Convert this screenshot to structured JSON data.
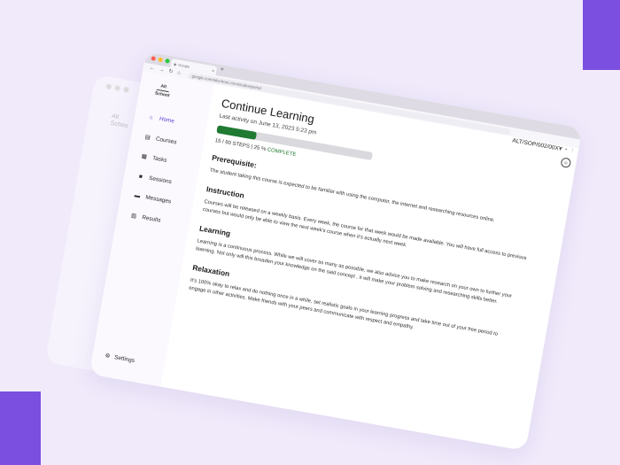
{
  "browser": {
    "tab_title": "Google",
    "new_tab_glyph": "+",
    "url": "google.com/altschool.com/studentportal",
    "window_dots": [
      "#ff5f57",
      "#febc2e",
      "#28c840"
    ]
  },
  "ghost_window": {
    "logo_line1": "Alt",
    "logo_line2": "Schoo"
  },
  "sidebar": {
    "logo_line1": "Alt",
    "logo_line2": "School",
    "items": [
      {
        "label": "Home",
        "icon": "home-icon",
        "active": true
      },
      {
        "label": "Courses",
        "icon": "book-icon",
        "active": false
      },
      {
        "label": "Tasks",
        "icon": "grid-icon",
        "active": false
      },
      {
        "label": "Sessions",
        "icon": "video-icon",
        "active": false
      },
      {
        "label": "Messages",
        "icon": "chat-icon",
        "active": false
      },
      {
        "label": "Results",
        "icon": "document-icon",
        "active": false
      }
    ],
    "settings_label": "Settings"
  },
  "header": {
    "title": "Continue Learning",
    "last_activity": "Last activity on June 13, 2023  5:23 pm",
    "student_id": "ALT/SOP/002/00XY"
  },
  "progress": {
    "fraction": 0.25,
    "steps_text": "15 / 60 STEPS",
    "separator": "|",
    "percent_text": "25 %",
    "complete_label": "COMPLETE"
  },
  "sections": [
    {
      "title": "Prerequisite:",
      "body": "The student taking this course is expected to be familiar with using the computer, the internet and researching resources online."
    },
    {
      "title": "Instruction",
      "body": "Courses will be released on a weekly basis. Every week, the course for that week would be made available. You will have full access to previous courses but would only be able to view the next week's course when it's actually next week."
    },
    {
      "title": "Learning",
      "body": "Learning is a continuous process. While we will cover as many as possible, we also advice you to make research on your own to further your learning. Not only will this broaden your knowledge on the said concept , it will make your problem solving and researching skills better."
    },
    {
      "title": "Relaxation",
      "body": "It's 100% okay to relax and do nothing once in a while, set realistic goals in your learning progress and take time out of your free period to engage in other activities. Make friends with your peers and communicate with respect and empathy."
    }
  ],
  "colors": {
    "accent": "#5b3fd6",
    "progress_fill": "#1f7a32",
    "progress_track": "#d9d9de",
    "brand_purple": "#7b4fe0",
    "background": "#f0eafb"
  }
}
